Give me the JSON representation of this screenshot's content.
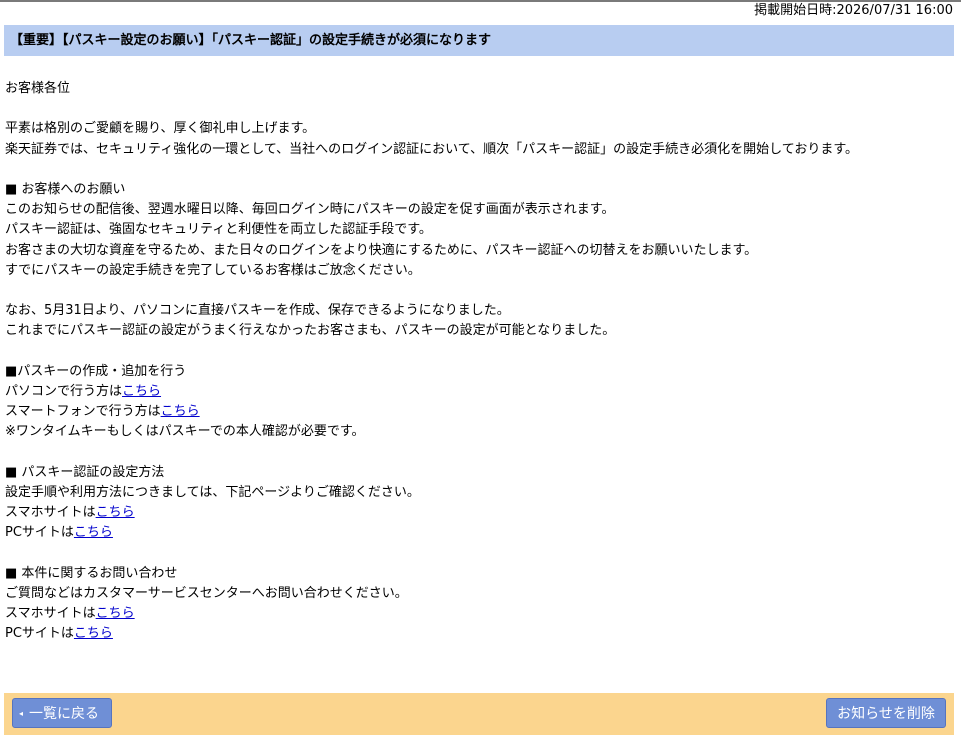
{
  "header": {
    "publish_date": "掲載開始日時:2026/07/31 16:00",
    "title": "【重要】【パスキー設定のお願い】「パスキー認証」の設定手続きが必須になります"
  },
  "body": {
    "greeting": "お客様各位",
    "intro": [
      "平素は格別のご愛顧を賜り、厚く御礼申し上げます。",
      "楽天証券では、セキュリティ強化の一環として、当社へのログイン認証において、順次「パスキー認証」の設定手続き必須化を開始しております。"
    ],
    "request": {
      "heading": "■ お客様へのお願い",
      "lines": [
        "このお知らせの配信後、翌週水曜日以降、毎回ログイン時にパスキーの設定を促す画面が表示されます。",
        "パスキー認証は、強固なセキュリティと利便性を両立した認証手段です。",
        "お客さまの大切な資産を守るため、また日々のログインをより快適にするために、パスキー認証への切替えをお願いいたします。",
        "すでにパスキーの設定手続きを完了しているお客様はご放念ください。"
      ]
    },
    "notice": [
      "なお、5月31日より、パソコンに直接パスキーを作成、保存できるようになりました。",
      "これまでにパスキー認証の設定がうまく行えなかったお客さまも、パスキーの設定が可能となりました。"
    ],
    "create": {
      "heading": "■パスキーの作成・追加を行う",
      "pc_prefix": "パソコンで行う方は",
      "pc_link": "こちら",
      "sp_prefix": "スマートフォンで行う方は",
      "sp_link": "こちら",
      "note": "※ワンタイムキーもしくはパスキーでの本人確認が必要です。"
    },
    "setup": {
      "heading": "■ パスキー認証の設定方法",
      "text": "設定手順や利用方法につきましては、下記ページよりご確認ください。",
      "sp_prefix": "スマホサイトは",
      "sp_link": "こちら",
      "pc_prefix": "PCサイトは",
      "pc_link": "こちら"
    },
    "contact": {
      "heading": "■ 本件に関するお問い合わせ",
      "text": "ご質問などはカスタマーサービスセンターへお問い合わせください。",
      "sp_prefix": "スマホサイトは",
      "sp_link": "こちら",
      "pc_prefix": "PCサイトは",
      "pc_link": "こちら"
    }
  },
  "footer": {
    "back_arrow": "◂",
    "back_label": "一覧に戻る",
    "delete_label": "お知らせを削除"
  },
  "colors": {
    "title_bar": "#b8cdf1",
    "footer_bar": "#fbd58e",
    "button": "#6f8fd6",
    "link": "#0000cc"
  }
}
